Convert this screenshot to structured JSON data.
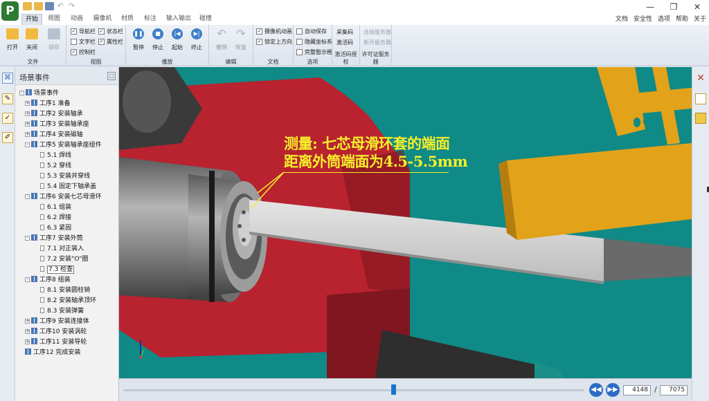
{
  "app": {
    "logo": "P",
    "window_controls": [
      "—",
      "❐",
      "✕"
    ]
  },
  "menu": {
    "tabs": [
      "开始",
      "视图",
      "动画",
      "摄像机",
      "材质",
      "标注",
      "输入输出",
      "碰撞"
    ],
    "active_tab": "开始",
    "right_links": [
      "文档",
      "安全性",
      "选项",
      "帮助",
      "关于"
    ]
  },
  "ribbon": {
    "file": {
      "label": "文件",
      "open": "打开",
      "close": "关闭",
      "save": "保存"
    },
    "view": {
      "label": "视图",
      "checks": [
        {
          "text": "导航栏",
          "checked": true
        },
        {
          "text": "文字栏",
          "checked": false
        },
        {
          "text": "控制栏",
          "checked": true
        },
        {
          "text": "状态栏",
          "checked": true
        },
        {
          "text": "属性栏",
          "checked": true
        }
      ]
    },
    "play": {
      "label": "播放",
      "pause": "暂停",
      "stop": "停止",
      "start": "起始",
      "end": "终止"
    },
    "edit": {
      "label": "编辑",
      "undo": "撤销",
      "redo": "恢复"
    },
    "doc": {
      "label": "文档",
      "checks": [
        {
          "text": "摄像机动画",
          "checked": true
        },
        {
          "text": "锁定上方向",
          "checked": true
        }
      ]
    },
    "options": {
      "label": "选项",
      "checks": [
        {
          "text": "自动保存",
          "checked": false
        },
        {
          "text": "隐藏坐标系",
          "checked": false
        },
        {
          "text": "完整暂示框",
          "checked": false
        }
      ]
    },
    "activation": {
      "label": "激活码授权",
      "collect": "采集码",
      "activate": "激活码"
    },
    "license": {
      "label": "许可证服务器",
      "connect": "连接服务器",
      "disconnect": "断开服务器"
    }
  },
  "panel": {
    "title": "场景事件",
    "pin": "□",
    "tree": [
      {
        "level": 0,
        "text": "场景事件",
        "toggle": "-",
        "icon": "group"
      },
      {
        "level": 1,
        "text": "工序1  准备",
        "toggle": "+",
        "icon": "group"
      },
      {
        "level": 1,
        "text": "工序2  安装轴承",
        "toggle": "+",
        "icon": "group"
      },
      {
        "level": 1,
        "text": "工序3  安装轴承座",
        "toggle": "+",
        "icon": "group"
      },
      {
        "level": 1,
        "text": "工序4  安装磁轴",
        "toggle": "+",
        "icon": "group"
      },
      {
        "level": 1,
        "text": "工序5  安装轴承座组件",
        "toggle": "-",
        "icon": "group"
      },
      {
        "level": 2,
        "text": "5.1  焊线",
        "icon": "doc"
      },
      {
        "level": 2,
        "text": "5.2  穿线",
        "icon": "doc"
      },
      {
        "level": 2,
        "text": "5.3  安装并穿线",
        "icon": "doc"
      },
      {
        "level": 2,
        "text": "5.4  固定下轴承盖",
        "icon": "doc"
      },
      {
        "level": 1,
        "text": "工序6  安装七芯母滑环",
        "toggle": "-",
        "icon": "group"
      },
      {
        "level": 2,
        "text": "6.1  组装",
        "icon": "doc"
      },
      {
        "level": 2,
        "text": "6.2  焊接",
        "icon": "doc"
      },
      {
        "level": 2,
        "text": "6.3  紧固",
        "icon": "doc"
      },
      {
        "level": 1,
        "text": "工序7  安装外筒",
        "toggle": "-",
        "icon": "group"
      },
      {
        "level": 2,
        "text": "7.1  对正装入",
        "icon": "doc"
      },
      {
        "level": 2,
        "text": "7.2  安装\"O\"圈",
        "icon": "doc"
      },
      {
        "level": 2,
        "text": "7.3  检查",
        "icon": "doc",
        "selected": true
      },
      {
        "level": 1,
        "text": "工序8  组装",
        "toggle": "-",
        "icon": "group"
      },
      {
        "level": 2,
        "text": "8.1  安装圆柱销",
        "icon": "doc"
      },
      {
        "level": 2,
        "text": "8.2  安装轴承顶环",
        "icon": "doc"
      },
      {
        "level": 2,
        "text": "8.3  安装弹簧",
        "icon": "doc"
      },
      {
        "level": 1,
        "text": "工序9  安装连接体",
        "toggle": "+",
        "icon": "group"
      },
      {
        "level": 1,
        "text": "工序10  安装涡轮",
        "toggle": "+",
        "icon": "group"
      },
      {
        "level": 1,
        "text": "工序11  安装导轮",
        "toggle": "+",
        "icon": "group"
      },
      {
        "level": 1,
        "text": "工序12  完成安装",
        "icon": "group"
      }
    ]
  },
  "viewport": {
    "annotation_line1": "测量: 七芯母滑环套的端面",
    "annotation_line2": "距离外筒端面为4.5-5.5mm",
    "colors": {
      "background": "#0f8a86",
      "red_part": "#b8232f",
      "yellow_part": "#e2a21a",
      "annotation": "#f5ee2a"
    }
  },
  "player": {
    "current_frame": "4148",
    "separator": "/",
    "total_frames": "7075",
    "progress": 0.586,
    "prev_icon": "rewind-icon",
    "next_icon": "forward-icon"
  }
}
